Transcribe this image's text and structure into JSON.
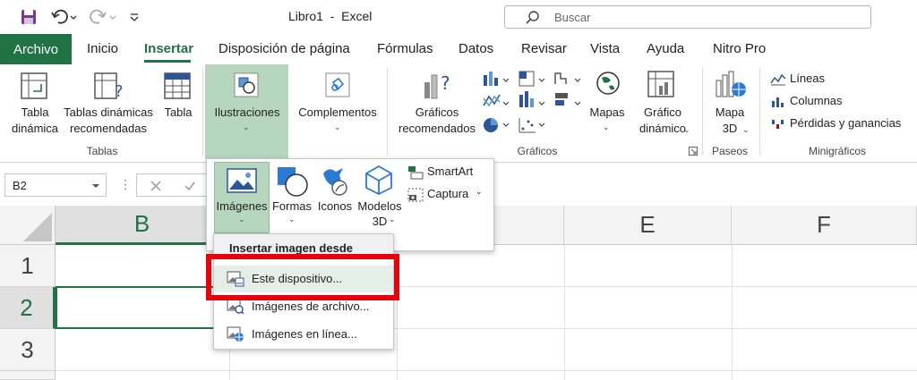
{
  "window": {
    "title": "Libro1  -  Excel"
  },
  "search": {
    "placeholder": "Buscar"
  },
  "tabs": [
    "Archivo",
    "Inicio",
    "Insertar",
    "Disposición de página",
    "Fórmulas",
    "Datos",
    "Revisar",
    "Vista",
    "Ayuda",
    "Nitro Pro"
  ],
  "active_tab": "Insertar",
  "ribbon": {
    "tablas": {
      "tabla_dinamica_l1": "Tabla",
      "tabla_dinamica_l2": "dinámica",
      "tablas_recomendadas_l1": "Tablas dinámicas",
      "tablas_recomendadas_l2": "recomendadas",
      "tabla": "Tabla",
      "group": "Tablas"
    },
    "ilustraciones": "Ilustraciones",
    "complementos": "Complementos",
    "graficos": {
      "recomendados_l1": "Gráficos",
      "recomendados_l2": "recomendados",
      "mapas": "Mapas",
      "grafico_dinamico_l1": "Gráfico",
      "grafico_dinamico_l2": "dinámico",
      "group": "Gráficos"
    },
    "paseos": {
      "mapa_l1": "Mapa",
      "mapa_l2": "3D",
      "group": "Paseos"
    },
    "minigraficos": {
      "lineas": "Líneas",
      "columnas": "Columnas",
      "perdidas": "Pérdidas y ganancias",
      "group": "Minigráficos"
    }
  },
  "namebox": {
    "value": "B2"
  },
  "columns": [
    "B",
    "",
    "",
    "E",
    "F"
  ],
  "rows": [
    "1",
    "2",
    "3"
  ],
  "ilus_menu": {
    "imagenes": "Imágenes",
    "formas": "Formas",
    "iconos": "Iconos",
    "modelos_l1": "Modelos",
    "modelos_l2": "3D",
    "smartart": "SmartArt",
    "captura": "Captura"
  },
  "image_menu": {
    "header": "Insertar imagen desde",
    "items": [
      "Este dispositivo...",
      "Imágenes de archivo...",
      "Imágenes en línea..."
    ]
  },
  "colors": {
    "accent": "#217346",
    "highlight": "#e8000b",
    "selected_bg": "#b6d7bd"
  }
}
